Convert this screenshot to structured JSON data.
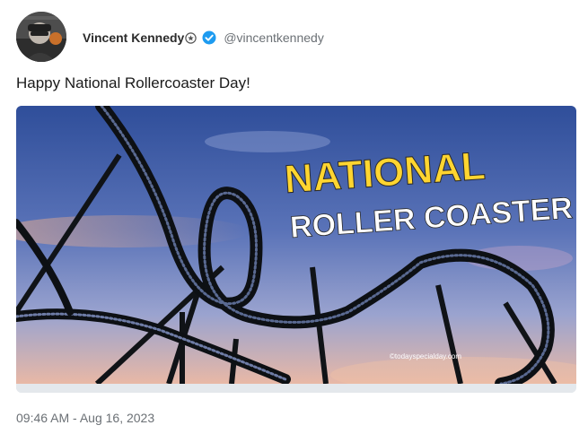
{
  "author": {
    "display_name": "Vincent Kennedy",
    "handle": "@vincentkennedy",
    "verified": true,
    "badge_icon": "circle-star-icon",
    "verified_icon": "verified-check-icon",
    "verified_color": "#1d9bf0"
  },
  "tweet": {
    "text": "Happy National Rollercoaster Day!",
    "timestamp": "09:46 AM - Aug 16, 2023"
  },
  "media": {
    "headline_line1": "NATIONAL",
    "headline_line2": "ROLLER COASTER DAY",
    "watermark": "©todayspecialday.com",
    "headline1_color": "#ffd530",
    "headline2_color": "#ffffff"
  }
}
